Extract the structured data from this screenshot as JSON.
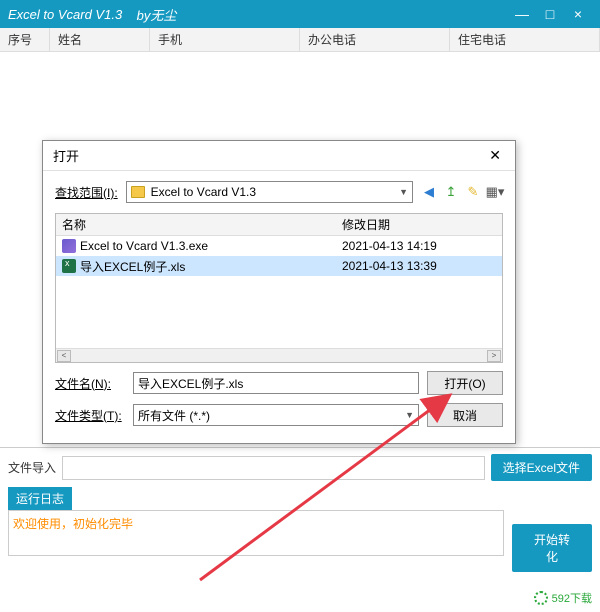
{
  "titlebar": {
    "app": "Excel to Vcard V1.3",
    "by": "by无尘"
  },
  "columns": {
    "c0": "序号",
    "c1": "姓名",
    "c2": "手机",
    "c3": "办公电话",
    "c4": "住宅电话"
  },
  "bottom": {
    "file_label": "文件导入",
    "select_btn": "选择Excel文件",
    "runlog_label": "运行日志",
    "log_text": "欢迎使用，初始化完毕",
    "start_btn": "开始转化"
  },
  "dialog": {
    "title": "打开",
    "lookin_label": "查找范围(I):",
    "folder_name": "Excel to Vcard V1.3",
    "col_name": "名称",
    "col_date": "修改日期",
    "files": [
      {
        "name": "Excel to Vcard V1.3.exe",
        "date": "2021-04-13 14:19"
      },
      {
        "name": "导入EXCEL例子.xls",
        "date": "2021-04-13 13:39"
      }
    ],
    "filename_label": "文件名(N):",
    "filename_value": "导入EXCEL例子.xls",
    "filetype_label": "文件类型(T):",
    "filetype_value": "所有文件 (*.*)",
    "open_btn": "打开(O)",
    "cancel_btn": "取消"
  },
  "watermark": "592下载"
}
